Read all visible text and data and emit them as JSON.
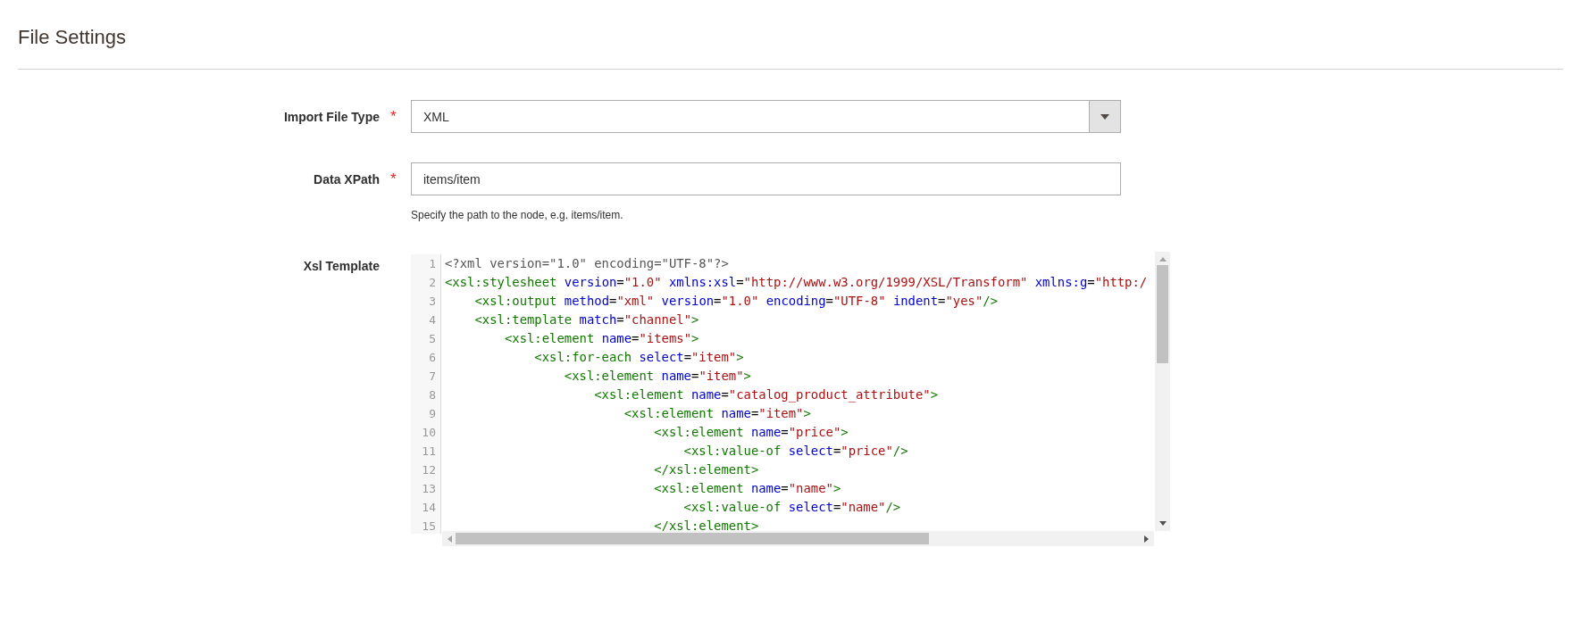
{
  "section": {
    "title": "File Settings"
  },
  "fields": [
    {
      "kind": "select",
      "label": "Import File Type",
      "required_mark": "*",
      "value": "XML"
    },
    {
      "kind": "text",
      "label": "Data XPath",
      "required_mark": "*",
      "value": "items/item",
      "note": "Specify the path to the node, e.g. items/item."
    },
    {
      "kind": "code",
      "label": "Xsl Template",
      "lines": [
        {
          "number": "1",
          "tokens": [
            {
              "kind": "meta",
              "text": "<?xml version=\"1.0\" encoding=\"UTF-8\"?>"
            }
          ]
        },
        {
          "number": "2",
          "tokens": [
            {
              "kind": "tag",
              "text": "<xsl:stylesheet"
            },
            {
              "kind": "attr",
              "text": " version"
            },
            {
              "kind": "plain",
              "text": "="
            },
            {
              "kind": "string",
              "text": "\"1.0\""
            },
            {
              "kind": "attr",
              "text": " xmlns:xsl"
            },
            {
              "kind": "plain",
              "text": "="
            },
            {
              "kind": "string",
              "text": "\"http://www.w3.org/1999/XSL/Transform\""
            },
            {
              "kind": "attr",
              "text": " xmlns:g"
            },
            {
              "kind": "plain",
              "text": "="
            },
            {
              "kind": "string",
              "text": "\"http:/"
            }
          ]
        },
        {
          "number": "3",
          "tokens": [
            {
              "kind": "tag",
              "text": "    <xsl:output"
            },
            {
              "kind": "attr",
              "text": " method"
            },
            {
              "kind": "plain",
              "text": "="
            },
            {
              "kind": "string",
              "text": "\"xml\""
            },
            {
              "kind": "attr",
              "text": " version"
            },
            {
              "kind": "plain",
              "text": "="
            },
            {
              "kind": "string",
              "text": "\"1.0\""
            },
            {
              "kind": "attr",
              "text": " encoding"
            },
            {
              "kind": "plain",
              "text": "="
            },
            {
              "kind": "string",
              "text": "\"UTF-8\""
            },
            {
              "kind": "attr",
              "text": " indent"
            },
            {
              "kind": "plain",
              "text": "="
            },
            {
              "kind": "string",
              "text": "\"yes\""
            },
            {
              "kind": "tag",
              "text": "/>"
            }
          ]
        },
        {
          "number": "4",
          "tokens": [
            {
              "kind": "tag",
              "text": "    <xsl:template"
            },
            {
              "kind": "attr",
              "text": " match"
            },
            {
              "kind": "plain",
              "text": "="
            },
            {
              "kind": "string",
              "text": "\"channel\""
            },
            {
              "kind": "tag",
              "text": ">"
            }
          ]
        },
        {
          "number": "5",
          "tokens": [
            {
              "kind": "tag",
              "text": "        <xsl:element"
            },
            {
              "kind": "attr",
              "text": " name"
            },
            {
              "kind": "plain",
              "text": "="
            },
            {
              "kind": "string",
              "text": "\"items\""
            },
            {
              "kind": "tag",
              "text": ">"
            }
          ]
        },
        {
          "number": "6",
          "tokens": [
            {
              "kind": "tag",
              "text": "            <xsl:for-each"
            },
            {
              "kind": "attr",
              "text": " select"
            },
            {
              "kind": "plain",
              "text": "="
            },
            {
              "kind": "string",
              "text": "\"item\""
            },
            {
              "kind": "tag",
              "text": ">"
            }
          ]
        },
        {
          "number": "7",
          "tokens": [
            {
              "kind": "tag",
              "text": "                <xsl:element"
            },
            {
              "kind": "attr",
              "text": " name"
            },
            {
              "kind": "plain",
              "text": "="
            },
            {
              "kind": "string",
              "text": "\"item\""
            },
            {
              "kind": "tag",
              "text": ">"
            }
          ]
        },
        {
          "number": "8",
          "tokens": [
            {
              "kind": "tag",
              "text": "                    <xsl:element"
            },
            {
              "kind": "attr",
              "text": " name"
            },
            {
              "kind": "plain",
              "text": "="
            },
            {
              "kind": "string",
              "text": "\"catalog_product_attribute\""
            },
            {
              "kind": "tag",
              "text": ">"
            }
          ]
        },
        {
          "number": "9",
          "tokens": [
            {
              "kind": "tag",
              "text": "                        <xsl:element"
            },
            {
              "kind": "attr",
              "text": " name"
            },
            {
              "kind": "plain",
              "text": "="
            },
            {
              "kind": "string",
              "text": "\"item\""
            },
            {
              "kind": "tag",
              "text": ">"
            }
          ]
        },
        {
          "number": "10",
          "tokens": [
            {
              "kind": "tag",
              "text": "                            <xsl:element"
            },
            {
              "kind": "attr",
              "text": " name"
            },
            {
              "kind": "plain",
              "text": "="
            },
            {
              "kind": "string",
              "text": "\"price\""
            },
            {
              "kind": "tag",
              "text": ">"
            }
          ]
        },
        {
          "number": "11",
          "tokens": [
            {
              "kind": "tag",
              "text": "                                <xsl:value-of"
            },
            {
              "kind": "attr",
              "text": " select"
            },
            {
              "kind": "plain",
              "text": "="
            },
            {
              "kind": "string",
              "text": "\"price\""
            },
            {
              "kind": "tag",
              "text": "/>"
            }
          ]
        },
        {
          "number": "12",
          "tokens": [
            {
              "kind": "tag",
              "text": "                            </xsl:element>"
            }
          ]
        },
        {
          "number": "13",
          "tokens": [
            {
              "kind": "tag",
              "text": "                            <xsl:element"
            },
            {
              "kind": "attr",
              "text": " name"
            },
            {
              "kind": "plain",
              "text": "="
            },
            {
              "kind": "string",
              "text": "\"name\""
            },
            {
              "kind": "tag",
              "text": ">"
            }
          ]
        },
        {
          "number": "14",
          "tokens": [
            {
              "kind": "tag",
              "text": "                                <xsl:value-of"
            },
            {
              "kind": "attr",
              "text": " select"
            },
            {
              "kind": "plain",
              "text": "="
            },
            {
              "kind": "string",
              "text": "\"name\""
            },
            {
              "kind": "tag",
              "text": "/>"
            }
          ]
        },
        {
          "number": "15",
          "tokens": [
            {
              "kind": "tag",
              "text": "                            </xsl:element>"
            }
          ]
        }
      ]
    }
  ]
}
